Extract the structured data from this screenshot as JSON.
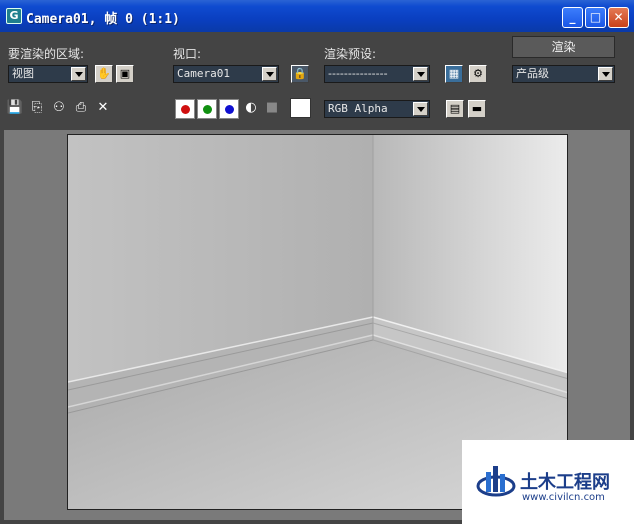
{
  "window": {
    "title": "Camera01, 帧 0 (1:1)",
    "app_icon_letter": "G",
    "controls": {
      "minimize": "_",
      "maximize": "□",
      "close": "✕"
    }
  },
  "toolbar": {
    "area_label": "要渲染的区域:",
    "area_value": "视图",
    "viewport_label": "视口:",
    "viewport_value": "Camera01",
    "preset_label": "渲染预设:",
    "preset_value": "---------------",
    "render_button": "渲染",
    "quality_value": "产品级",
    "channel_value": "RGB Alpha",
    "colors": {
      "red": "#d01010",
      "green": "#109010",
      "blue": "#1010d0"
    }
  },
  "icons": [
    "save-icon",
    "copy-icon",
    "clone-icon",
    "print-icon",
    "clear-icon",
    "pan-hand-icon",
    "region-icon",
    "lock-viewport-icon",
    "render-setup-icon",
    "environment-icon",
    "mono-icon",
    "swatch-icon",
    "display-toggle-icon",
    "display-black-icon"
  ],
  "watermark": {
    "title": "土木工程网",
    "url": "www.civilcn.com"
  }
}
